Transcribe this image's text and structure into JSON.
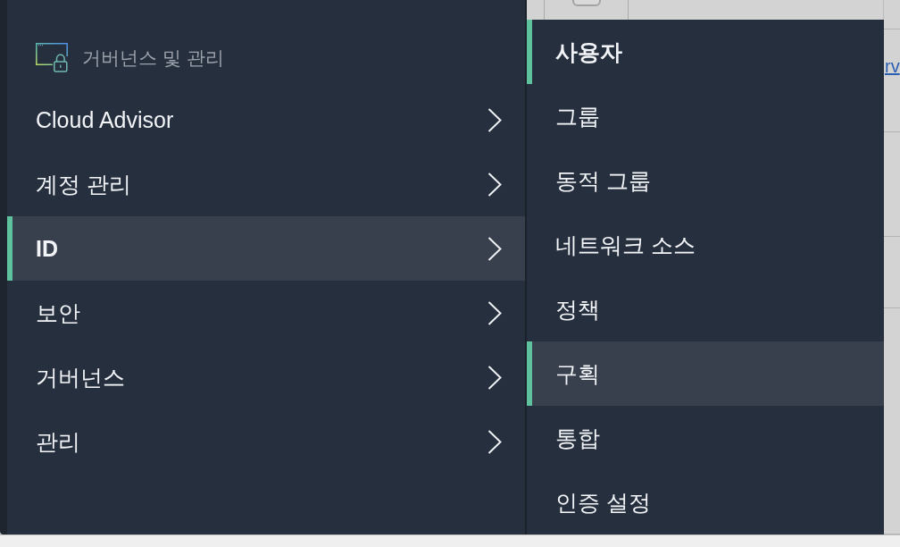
{
  "background_table": {
    "header": {
      "checked": false
    },
    "rows": [
      {
        "link": "rv"
      }
    ]
  },
  "navigation_menu": {
    "section_title": "거버넌스 및 관리",
    "items": [
      {
        "label": "Cloud Advisor",
        "selected": false
      },
      {
        "label": "계정 관리",
        "selected": false
      },
      {
        "label": "ID",
        "selected": true
      },
      {
        "label": "보안",
        "selected": false
      },
      {
        "label": "거버넌스",
        "selected": false
      },
      {
        "label": "관리",
        "selected": false
      }
    ]
  },
  "submenu": {
    "items": [
      {
        "label": "사용자",
        "selected": true,
        "highlighted": false
      },
      {
        "label": "그룹",
        "selected": false,
        "highlighted": false
      },
      {
        "label": "동적 그룹",
        "selected": false,
        "highlighted": false
      },
      {
        "label": "네트워크 소스",
        "selected": false,
        "highlighted": false
      },
      {
        "label": "정책",
        "selected": false,
        "highlighted": false
      },
      {
        "label": "구획",
        "selected": false,
        "highlighted": true
      },
      {
        "label": "통합",
        "selected": false,
        "highlighted": false
      },
      {
        "label": "인증 설정",
        "selected": false,
        "highlighted": false
      }
    ]
  }
}
